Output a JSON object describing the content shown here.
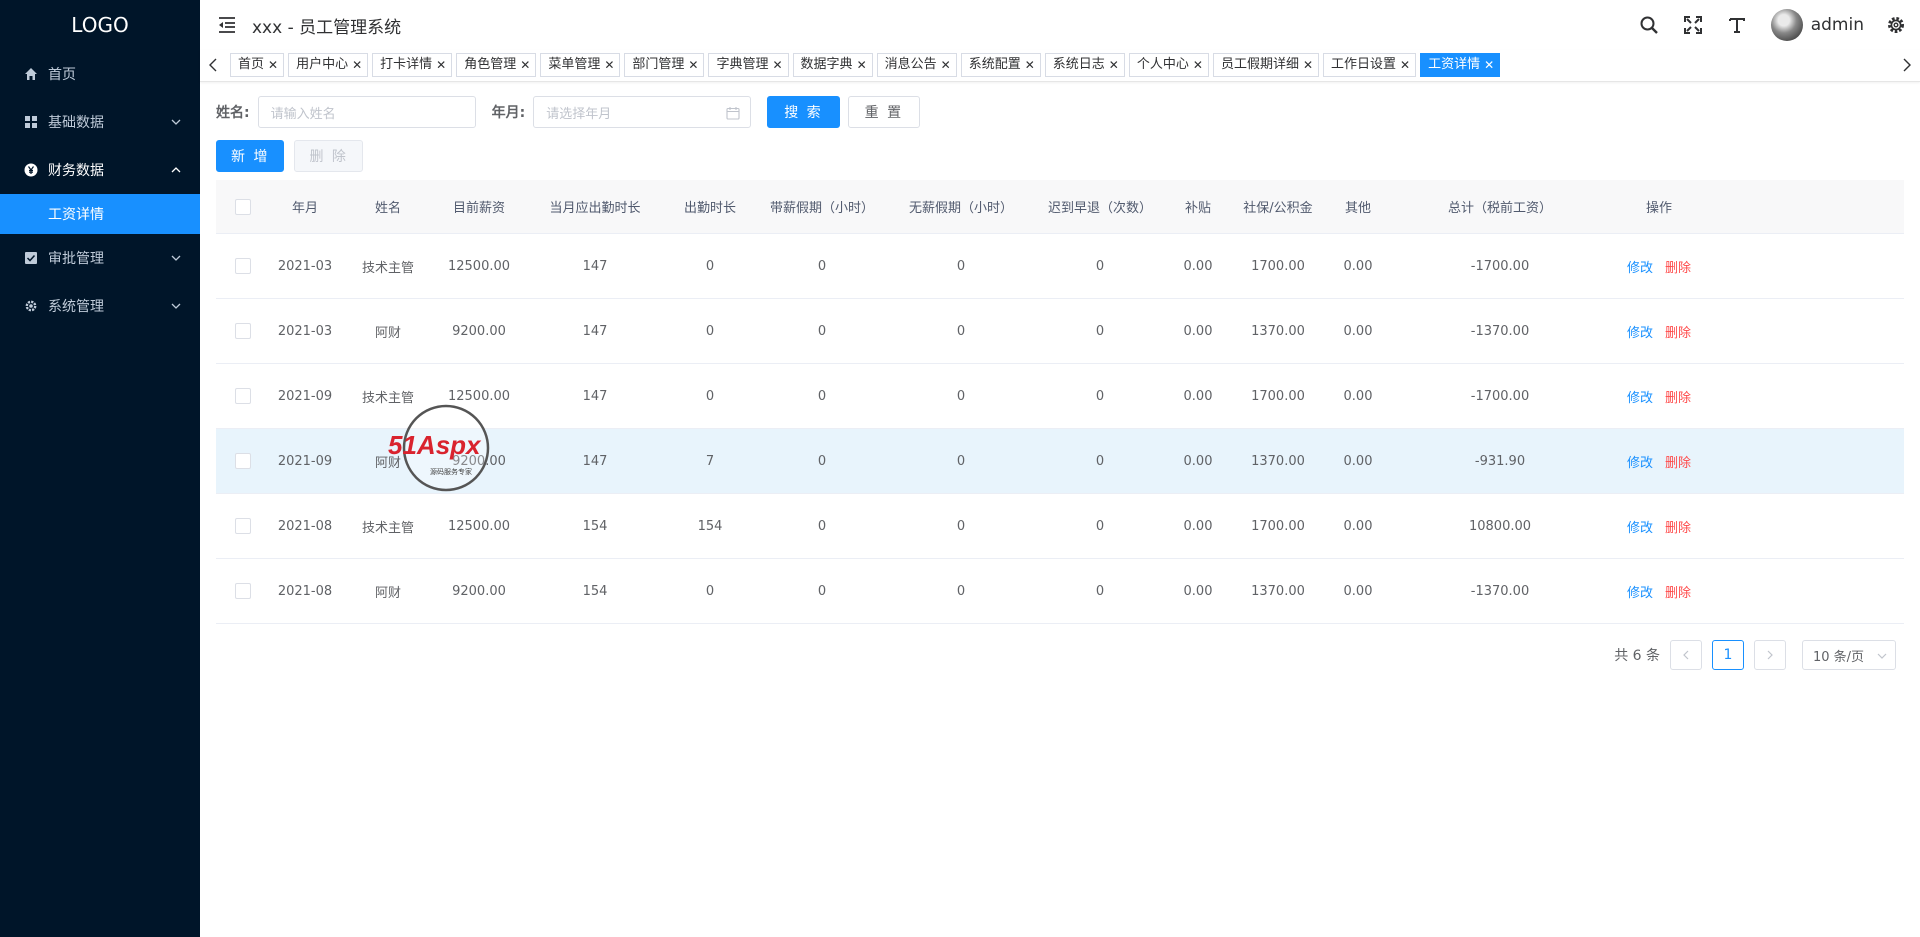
{
  "app": {
    "logo": "LOGO",
    "title": "xxx - 员工管理系统",
    "username": "admin"
  },
  "sidebar": {
    "items": [
      {
        "label": "首页",
        "icon": "home-icon",
        "has_children": false
      },
      {
        "label": "基础数据",
        "icon": "dashboard-icon",
        "has_children": true
      },
      {
        "label": "财务数据",
        "icon": "yen-icon",
        "has_children": true,
        "open": true
      },
      {
        "label": "审批管理",
        "icon": "checkbox-icon",
        "has_children": true
      },
      {
        "label": "系统管理",
        "icon": "gear-icon",
        "has_children": true
      }
    ],
    "active_sub": "工资详情"
  },
  "tags": [
    "首页",
    "用户中心",
    "打卡详情",
    "角色管理",
    "菜单管理",
    "部门管理",
    "字典管理",
    "数据字典",
    "消息公告",
    "系统配置",
    "系统日志",
    "个人中心",
    "员工假期详细",
    "工作日设置",
    "工资详情"
  ],
  "search": {
    "name_label": "姓名:",
    "name_placeholder": "请输入姓名",
    "month_label": "年月:",
    "month_placeholder": "请选择年月",
    "search_btn": "搜 索",
    "reset_btn": "重 置"
  },
  "ops": {
    "add_btn": "新 增",
    "delete_btn": "删 除"
  },
  "table": {
    "columns": [
      "年月",
      "姓名",
      "目前薪资",
      "当月应出勤时长",
      "出勤时长",
      "带薪假期（小时）",
      "无薪假期（小时）",
      "迟到早退（次数）",
      "补贴",
      "社保/公积金",
      "其他",
      "总计（税前工资）",
      "操作"
    ],
    "rows": [
      [
        "2021-03",
        "技术主管",
        "12500.00",
        "147",
        "0",
        "0",
        "0",
        "0",
        "0.00",
        "1700.00",
        "0.00",
        "-1700.00"
      ],
      [
        "2021-03",
        "阿财",
        "9200.00",
        "147",
        "0",
        "0",
        "0",
        "0",
        "0.00",
        "1370.00",
        "0.00",
        "-1370.00"
      ],
      [
        "2021-09",
        "技术主管",
        "12500.00",
        "147",
        "0",
        "0",
        "0",
        "0",
        "0.00",
        "1700.00",
        "0.00",
        "-1700.00"
      ],
      [
        "2021-09",
        "阿财",
        "9200.00",
        "147",
        "7",
        "0",
        "0",
        "0",
        "0.00",
        "1370.00",
        "0.00",
        "-931.90"
      ],
      [
        "2021-08",
        "技术主管",
        "12500.00",
        "154",
        "154",
        "0",
        "0",
        "0",
        "0.00",
        "1700.00",
        "0.00",
        "10800.00"
      ],
      [
        "2021-08",
        "阿财",
        "9200.00",
        "154",
        "0",
        "0",
        "0",
        "0",
        "0.00",
        "1370.00",
        "0.00",
        "-1370.00"
      ]
    ],
    "edit_label": "修改",
    "delete_label": "删除",
    "hover_row": 3
  },
  "pager": {
    "total": "共 6 条",
    "page": "1",
    "page_size": "10 条/页"
  },
  "watermark": {
    "text": "51Aspx",
    "sub": "源码服务专家"
  },
  "colors": {
    "sidebar_bg": "#001529",
    "accent": "#1890ff",
    "danger": "#ff4949",
    "row_hover": "#e8f4fc"
  }
}
